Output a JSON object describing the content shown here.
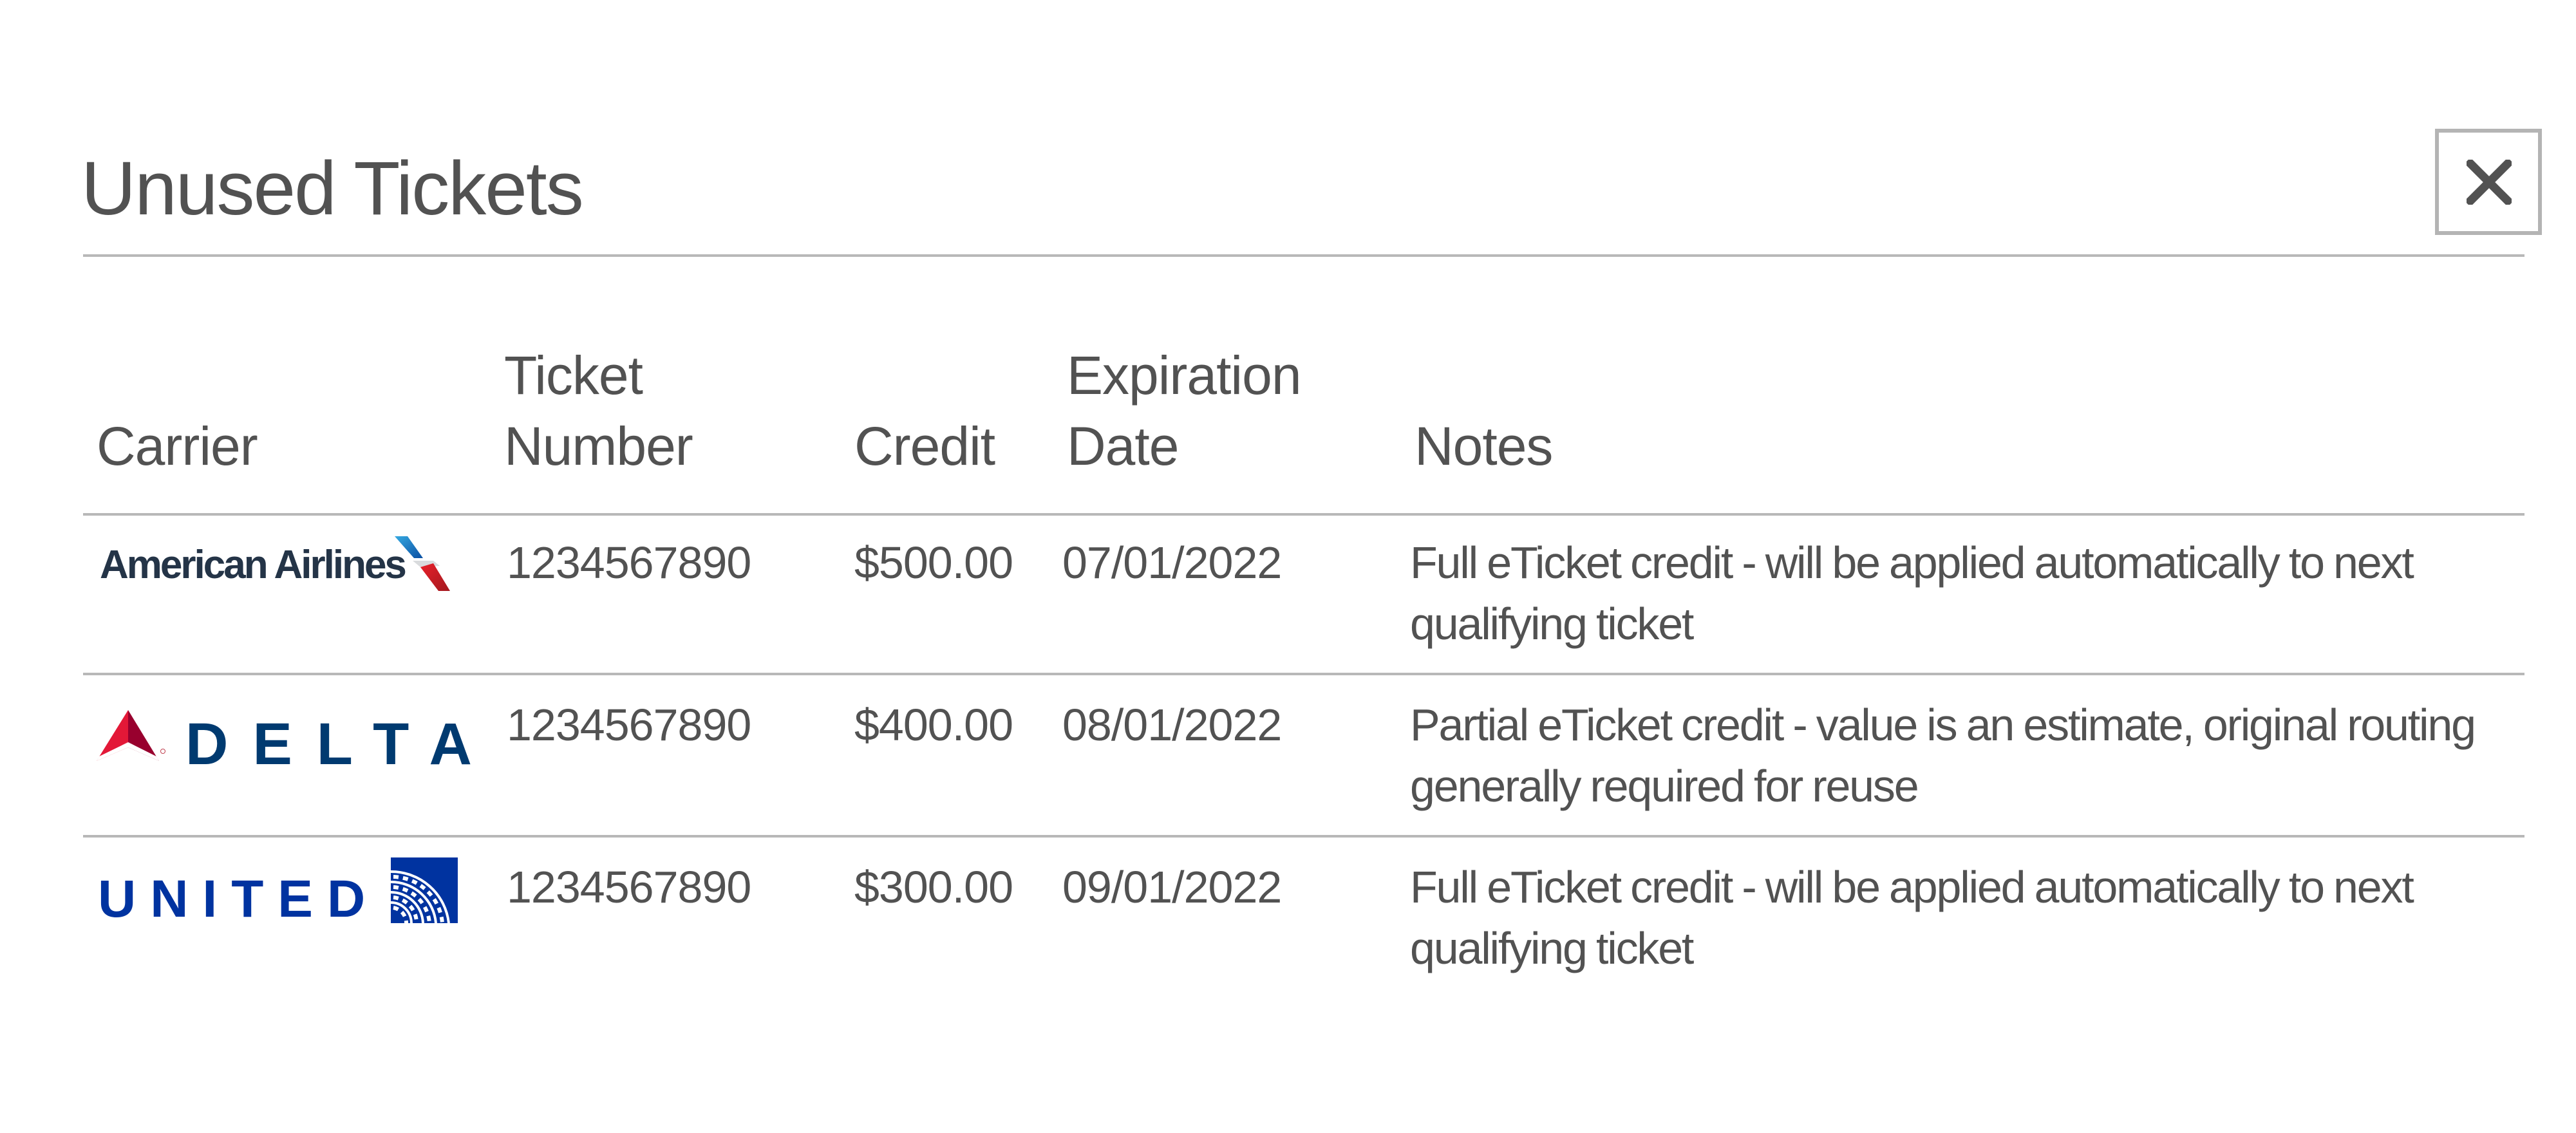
{
  "dialog": {
    "title": "Unused Tickets",
    "close_label": "Close",
    "close_icon": "close-x-icon"
  },
  "table": {
    "headers": {
      "carrier": "Carrier",
      "ticket_number_line1": "Ticket",
      "ticket_number_line2": "Number",
      "credit": "Credit",
      "expiration_line1": "Expiration",
      "expiration_line2": "Date",
      "notes": "Notes"
    },
    "rows": [
      {
        "carrier": "American Airlines",
        "carrier_logo_icon": "american-airlines-logo",
        "ticket_number": "1234567890",
        "credit": "$500.00",
        "expiration_date": "07/01/2022",
        "notes": "Full eTicket credit - will be applied automatically to next qualifying ticket"
      },
      {
        "carrier": "DELTA",
        "carrier_logo_icon": "delta-logo",
        "ticket_number": "1234567890",
        "credit": "$400.00",
        "expiration_date": "08/01/2022",
        "notes": "Partial eTicket credit - value is an estimate, original routing generally required for reuse"
      },
      {
        "carrier": "UNITED",
        "carrier_logo_icon": "united-logo",
        "ticket_number": "1234567890",
        "credit": "$300.00",
        "expiration_date": "09/01/2022",
        "notes": "Full eTicket credit - will be applied automatically to next qualifying ticket"
      }
    ]
  },
  "colors": {
    "text": "#525252",
    "divider": "#b8b8b8",
    "aa_navy": "#243447",
    "delta_red": "#e31837",
    "delta_dark_red": "#98002e",
    "delta_blue": "#003a70",
    "united_blue": "#0033a0"
  }
}
